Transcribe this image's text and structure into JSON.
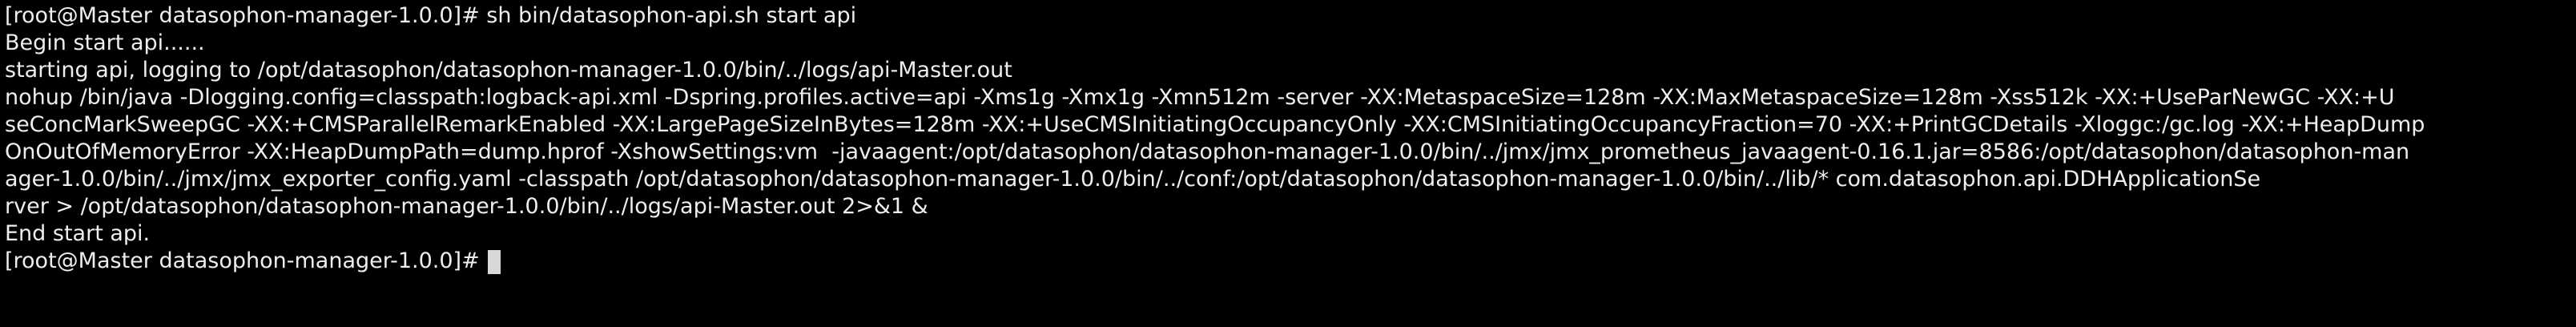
{
  "terminal": {
    "lines": [
      "[root@Master datasophon-manager-1.0.0]# sh bin/datasophon-api.sh start api",
      "Begin start api......",
      "starting api, logging to /opt/datasophon/datasophon-manager-1.0.0/bin/../logs/api-Master.out",
      "nohup /bin/java -Dlogging.config=classpath:logback-api.xml -Dspring.profiles.active=api -Xms1g -Xmx1g -Xmn512m -server -XX:MetaspaceSize=128m -XX:MaxMetaspaceSize=128m -Xss512k -XX:+UseParNewGC -XX:+U",
      "seConcMarkSweepGC -XX:+CMSParallelRemarkEnabled -XX:LargePageSizeInBytes=128m -XX:+UseCMSInitiatingOccupancyOnly -XX:CMSInitiatingOccupancyFraction=70 -XX:+PrintGCDetails -Xloggc:/gc.log -XX:+HeapDump",
      "OnOutOfMemoryError -XX:HeapDumpPath=dump.hprof -XshowSettings:vm  -javaagent:/opt/datasophon/datasophon-manager-1.0.0/bin/../jmx/jmx_prometheus_javaagent-0.16.1.jar=8586:/opt/datasophon/datasophon-man",
      "ager-1.0.0/bin/../jmx/jmx_exporter_config.yaml -classpath /opt/datasophon/datasophon-manager-1.0.0/bin/../conf:/opt/datasophon/datasophon-manager-1.0.0/bin/../lib/* com.datasophon.api.DDHApplicationSe",
      "rver > /opt/datasophon/datasophon-manager-1.0.0/bin/../logs/api-Master.out 2>&1 &",
      "End start api."
    ],
    "prompt": "[root@Master datasophon-manager-1.0.0]# ",
    "colors": {
      "background": "#000000",
      "foreground": "#eeeeee",
      "cursor": "#d8d8d8"
    }
  }
}
